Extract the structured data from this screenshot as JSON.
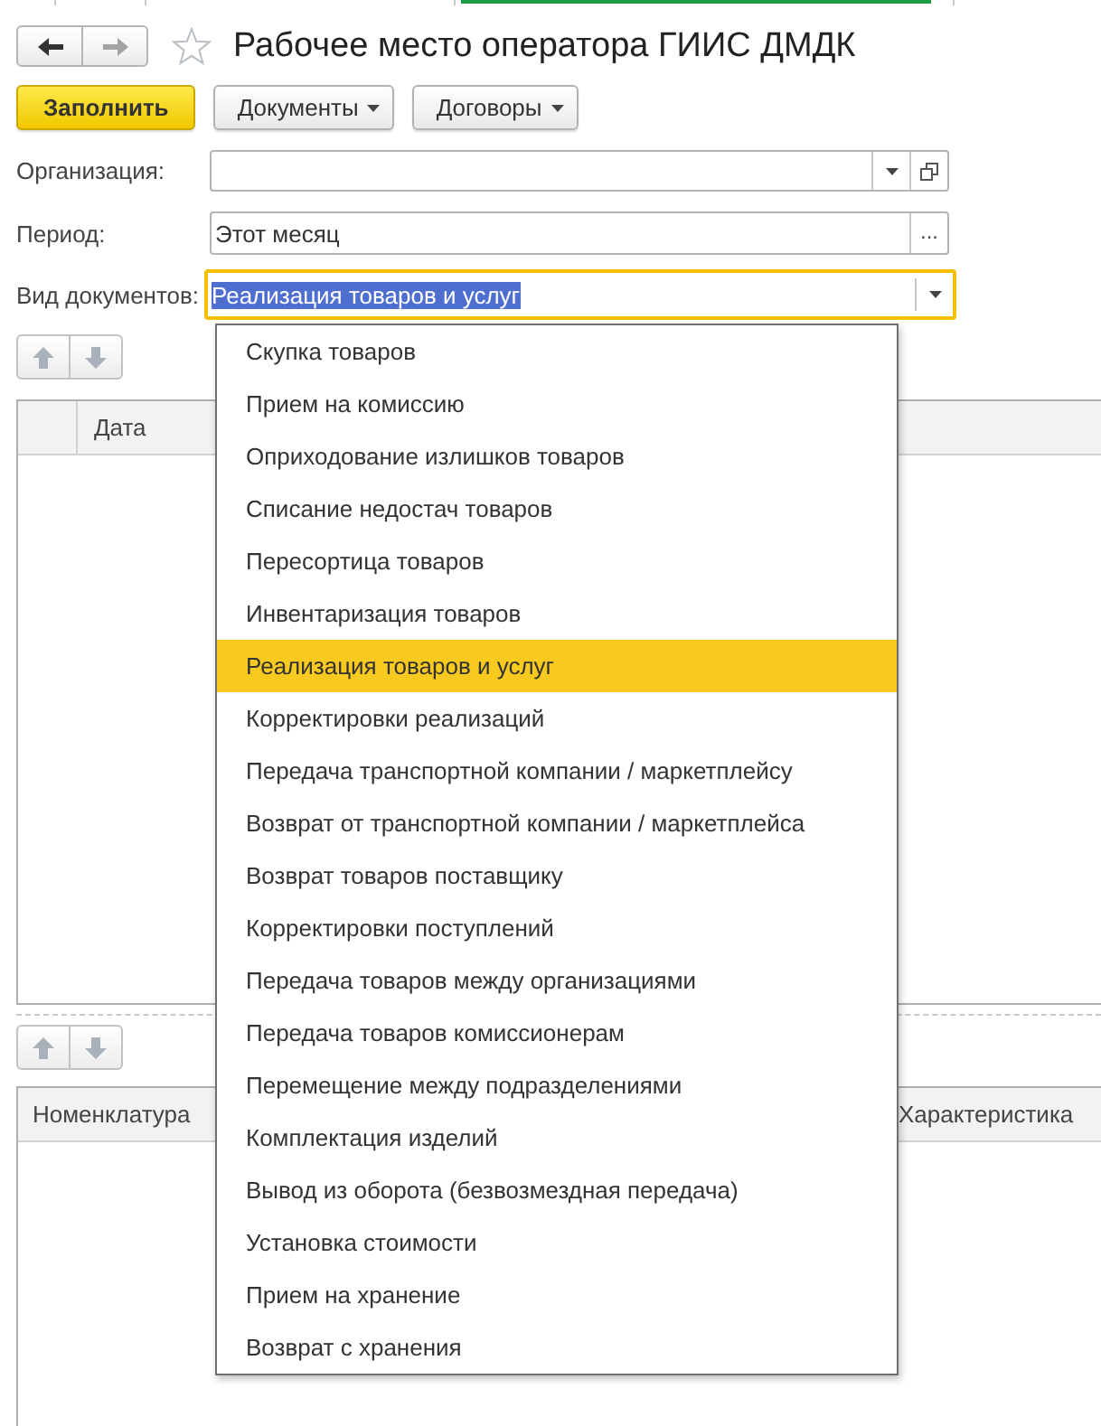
{
  "window": {
    "title": "Рабочее место оператора ГИИС ДМДК",
    "favorite": false
  },
  "navigation": [
    {
      "kind": "back",
      "disabled": false
    },
    {
      "kind": "forward",
      "disabled": true
    }
  ],
  "command_bar": [
    {
      "kind": "default",
      "label": "Заполнить"
    },
    {
      "kind": "menu",
      "label": "Документы"
    },
    {
      "kind": "menu",
      "label": "Договоры"
    }
  ],
  "fields": [
    {
      "kind": "reference",
      "label": "Организация:",
      "focused": false
    },
    {
      "kind": "period",
      "label": "Период:",
      "value": "Этот месяц",
      "button_label": "...",
      "focused": false,
      "text_selected": false
    },
    {
      "kind": "list",
      "label": "Вид документов:",
      "value": "Реализация товаров и услуг",
      "focused": true,
      "text_selected": true,
      "expanded": true,
      "options": [
        {
          "label": "Скупка товаров",
          "selected": false
        },
        {
          "label": "Прием на комиссию",
          "selected": false
        },
        {
          "label": "Оприходование излишков товаров",
          "selected": false
        },
        {
          "label": "Списание недостач товаров",
          "selected": false
        },
        {
          "label": "Пересортица товаров",
          "selected": false
        },
        {
          "label": "Инвентаризация товаров",
          "selected": false
        },
        {
          "label": "Реализация товаров и услуг",
          "selected": true
        },
        {
          "label": "Корректировки реализаций",
          "selected": false
        },
        {
          "label": "Передача транспортной компании / маркетплейсу",
          "selected": false
        },
        {
          "label": "Возврат от транспортной компании / маркетплейса",
          "selected": false
        },
        {
          "label": "Возврат товаров поставщику",
          "selected": false
        },
        {
          "label": "Корректировки поступлений",
          "selected": false
        },
        {
          "label": "Передача товаров между организациями",
          "selected": false
        },
        {
          "label": "Передача товаров комиссионерам",
          "selected": false
        },
        {
          "label": "Перемещение между подразделениями",
          "selected": false
        },
        {
          "label": "Комплектация изделий",
          "selected": false
        },
        {
          "label": "Вывод из оборота (безвозмездная передача)",
          "selected": false
        },
        {
          "label": "Установка стоимости",
          "selected": false
        },
        {
          "label": "Прием на хранение",
          "selected": false
        },
        {
          "label": "Возврат с хранения",
          "selected": false
        }
      ]
    }
  ],
  "documents_table": {
    "move_buttons": [
      {
        "kind": "up",
        "disabled": true
      },
      {
        "kind": "down",
        "disabled": true
      }
    ],
    "columns": [
      "Дата"
    ]
  },
  "goods_table": {
    "move_buttons": [
      {
        "kind": "up",
        "disabled": true
      },
      {
        "kind": "down",
        "disabled": true
      }
    ],
    "columns": [
      "Номенклатура",
      "Характеристика"
    ]
  }
}
